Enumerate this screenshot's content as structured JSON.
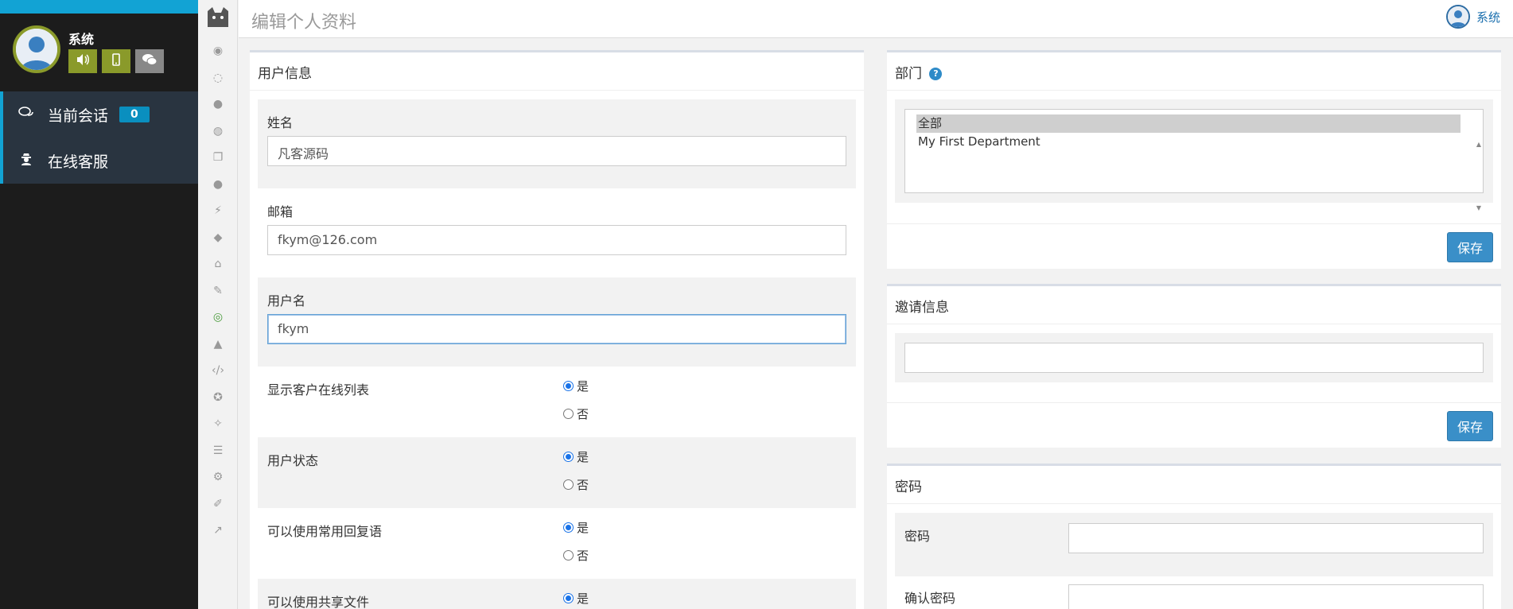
{
  "sidebar": {
    "profile_name": "系统",
    "buttons": [
      "sound-icon",
      "mobile-icon",
      "chat-icon"
    ],
    "nav": [
      {
        "label": "当前会话",
        "badge": "0",
        "icon": "chat-bubbles-icon"
      },
      {
        "label": "在线客服",
        "icon": "user-secret-icon"
      }
    ]
  },
  "rail": {
    "icons": [
      "eye-icon",
      "chat-icon",
      "comment-icon",
      "comments-icon",
      "copy-icon",
      "comment-solid-icon",
      "bolt-icon",
      "android-icon",
      "bank-icon",
      "pencil-icon",
      "user-circle-icon",
      "area-chart-icon",
      "code-icon",
      "users-icon",
      "magic-icon",
      "list-icon",
      "gear-icon",
      "wrench-icon",
      "line-chart-icon"
    ],
    "active": "user-circle-icon"
  },
  "header": {
    "title": "编辑个人资料",
    "user_name": "系统"
  },
  "user_panel": {
    "title": "用户信息",
    "name_label": "姓名",
    "name_value": "凡客源码",
    "email_label": "邮箱",
    "email_value": "fkym@126.com",
    "username_label": "用户名",
    "username_value": "fkym",
    "yes": "是",
    "no": "否",
    "options": [
      {
        "label": "显示客户在线列表",
        "value": "是"
      },
      {
        "label": "用户状态",
        "value": "是"
      },
      {
        "label": "可以使用常用回复语",
        "value": "是"
      },
      {
        "label": "可以使用共享文件",
        "value": "是"
      }
    ]
  },
  "dept_panel": {
    "title": "部门",
    "options": [
      "全部",
      "My First Department"
    ],
    "selected": "全部",
    "save_label": "保存"
  },
  "invite_panel": {
    "title": "邀请信息",
    "value": "",
    "save_label": "保存"
  },
  "pwd_panel": {
    "title": "密码",
    "password_label": "密码",
    "confirm_label": "确认密码"
  },
  "colors": {
    "sidebar_bg": "#1c1c1c",
    "accent": "#12a3d4",
    "olive": "#8a9a2a",
    "save": "#3a8fc8"
  }
}
